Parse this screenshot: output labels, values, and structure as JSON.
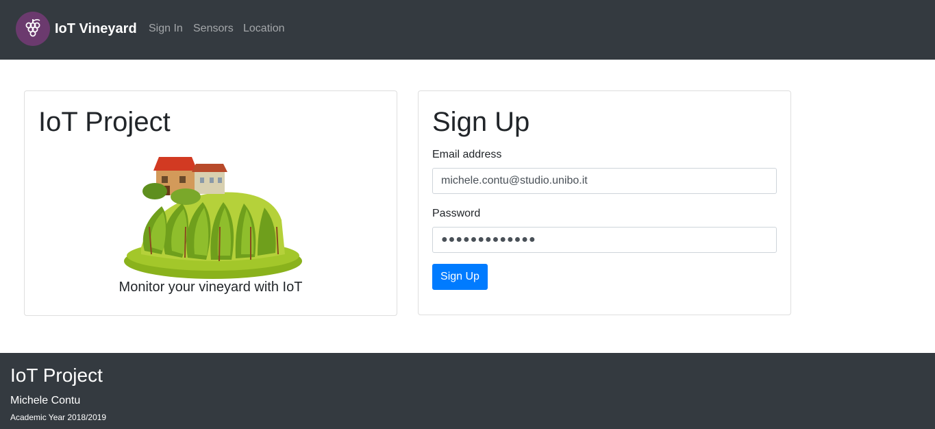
{
  "navbar": {
    "logo_icon": "grape-icon",
    "brand": "IoT Vineyard",
    "links": [
      "Sign In",
      "Sensors",
      "Location"
    ]
  },
  "project_card": {
    "title": "IoT Project",
    "image": "vineyard-illustration",
    "tagline": "Monitor your vineyard with IoT"
  },
  "signup_card": {
    "title": "Sign Up",
    "email_label": "Email address",
    "email_value": "michele.contu@studio.unibo.it",
    "password_label": "Password",
    "password_value": "●●●●●●●●●●●●●",
    "button": "Sign Up"
  },
  "footer": {
    "title": "IoT Project",
    "author": "Michele Contu",
    "year": "Academic Year 2018/2019"
  },
  "colors": {
    "navbar_bg": "#343a40",
    "primary": "#007bff",
    "logo_bg": "#6b3a6e"
  }
}
